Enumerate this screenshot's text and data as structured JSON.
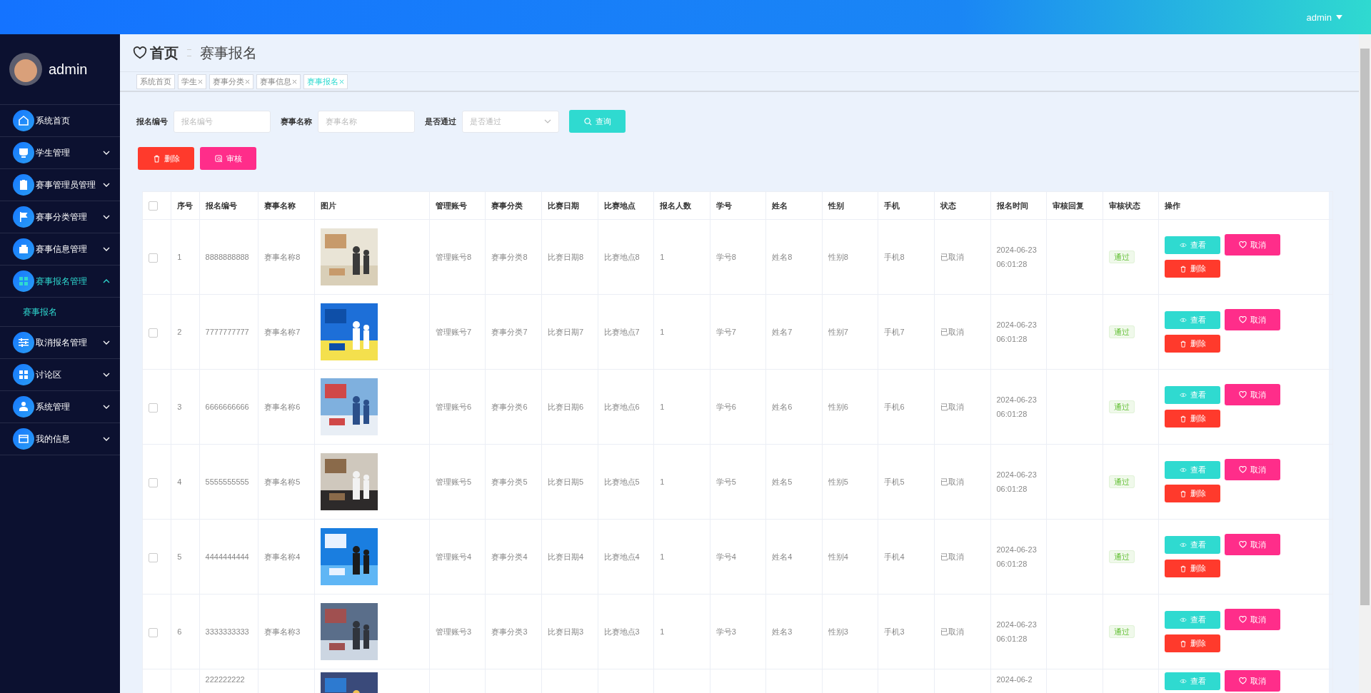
{
  "topbar": {
    "user": "admin"
  },
  "sidebar": {
    "user": "admin",
    "items": [
      {
        "label": "系统首页",
        "kind": "link",
        "selected": false
      },
      {
        "label": "学生管理",
        "kind": "group",
        "expanded": false,
        "selected": false
      },
      {
        "label": "赛事管理员管理",
        "kind": "group",
        "expanded": false,
        "selected": false
      },
      {
        "label": "赛事分类管理",
        "kind": "group",
        "expanded": false,
        "selected": false
      },
      {
        "label": "赛事信息管理",
        "kind": "group",
        "expanded": false,
        "selected": false
      },
      {
        "label": "赛事报名管理",
        "kind": "group",
        "expanded": true,
        "selected": true,
        "children": [
          {
            "label": "赛事报名",
            "selected": true
          }
        ]
      },
      {
        "label": "取消报名管理",
        "kind": "group",
        "expanded": false,
        "selected": false
      },
      {
        "label": "讨论区",
        "kind": "group",
        "expanded": false,
        "selected": false
      },
      {
        "label": "系统管理",
        "kind": "group",
        "expanded": false,
        "selected": false
      },
      {
        "label": "我的信息",
        "kind": "group",
        "expanded": false,
        "selected": false
      }
    ]
  },
  "breadcrumb": {
    "home": "首页",
    "current": "赛事报名"
  },
  "tabs": [
    {
      "label": "系统首页",
      "closable": false,
      "selected": false
    },
    {
      "label": "学生",
      "closable": true,
      "selected": false
    },
    {
      "label": "赛事分类",
      "closable": true,
      "selected": false
    },
    {
      "label": "赛事信息",
      "closable": true,
      "selected": false
    },
    {
      "label": "赛事报名",
      "closable": true,
      "selected": true
    }
  ],
  "filters": [
    {
      "label": "报名编号",
      "placeholder": "报名编号",
      "kind": "input"
    },
    {
      "label": "赛事名称",
      "placeholder": "赛事名称",
      "kind": "input"
    },
    {
      "label": "是否通过",
      "placeholder": "是否通过",
      "kind": "select"
    }
  ],
  "search_button": "查询",
  "actions": [
    {
      "label": "删除",
      "kind": "delete"
    },
    {
      "label": "审核",
      "kind": "review"
    }
  ],
  "table": {
    "all_checked": false,
    "columns": [
      "序号",
      "报名编号",
      "赛事名称",
      "图片",
      "管理账号",
      "赛事分类",
      "比赛日期",
      "比赛地点",
      "报名人数",
      "学号",
      "姓名",
      "性别",
      "手机",
      "状态",
      "报名时间",
      "审核回复",
      "审核状态",
      "操作"
    ],
    "rows": [
      {
        "checked": false,
        "cells": [
          "1",
          "8888888888",
          "赛事名称8",
          null,
          "管理账号8",
          "赛事分类8",
          "比赛日期8",
          "比赛地点8",
          "1",
          "学号8",
          "姓名8",
          "性别8",
          "手机8",
          "已取消",
          "2024-06-23 06:01:28",
          ""
        ],
        "image": {
          "kind": "picture"
        },
        "review_status": "通过",
        "buttons": [
          {
            "label": "查看",
            "kind": "view"
          },
          {
            "label": "取消",
            "kind": "cancel"
          },
          {
            "label": "删除",
            "kind": "delete"
          }
        ]
      },
      {
        "checked": false,
        "cells": [
          "2",
          "7777777777",
          "赛事名称7",
          null,
          "管理账号7",
          "赛事分类7",
          "比赛日期7",
          "比赛地点7",
          "1",
          "学号7",
          "姓名7",
          "性别7",
          "手机7",
          "已取消",
          "2024-06-23 06:01:28",
          ""
        ],
        "image": {
          "kind": "picture"
        },
        "review_status": "通过",
        "buttons": [
          {
            "label": "查看",
            "kind": "view"
          },
          {
            "label": "取消",
            "kind": "cancel"
          },
          {
            "label": "删除",
            "kind": "delete"
          }
        ]
      },
      {
        "checked": false,
        "cells": [
          "3",
          "6666666666",
          "赛事名称6",
          null,
          "管理账号6",
          "赛事分类6",
          "比赛日期6",
          "比赛地点6",
          "1",
          "学号6",
          "姓名6",
          "性别6",
          "手机6",
          "已取消",
          "2024-06-23 06:01:28",
          ""
        ],
        "image": {
          "kind": "picture"
        },
        "review_status": "通过",
        "buttons": [
          {
            "label": "查看",
            "kind": "view"
          },
          {
            "label": "取消",
            "kind": "cancel"
          },
          {
            "label": "删除",
            "kind": "delete"
          }
        ]
      },
      {
        "checked": false,
        "cells": [
          "4",
          "5555555555",
          "赛事名称5",
          null,
          "管理账号5",
          "赛事分类5",
          "比赛日期5",
          "比赛地点5",
          "1",
          "学号5",
          "姓名5",
          "性别5",
          "手机5",
          "已取消",
          "2024-06-23 06:01:28",
          ""
        ],
        "image": {
          "kind": "picture"
        },
        "review_status": "通过",
        "buttons": [
          {
            "label": "查看",
            "kind": "view"
          },
          {
            "label": "取消",
            "kind": "cancel"
          },
          {
            "label": "删除",
            "kind": "delete"
          }
        ]
      },
      {
        "checked": false,
        "cells": [
          "5",
          "4444444444",
          "赛事名称4",
          null,
          "管理账号4",
          "赛事分类4",
          "比赛日期4",
          "比赛地点4",
          "1",
          "学号4",
          "姓名4",
          "性别4",
          "手机4",
          "已取消",
          "2024-06-23 06:01:28",
          ""
        ],
        "image": {
          "kind": "picture"
        },
        "review_status": "通过",
        "buttons": [
          {
            "label": "查看",
            "kind": "view"
          },
          {
            "label": "取消",
            "kind": "cancel"
          },
          {
            "label": "删除",
            "kind": "delete"
          }
        ]
      },
      {
        "checked": false,
        "cells": [
          "6",
          "3333333333",
          "赛事名称3",
          null,
          "管理账号3",
          "赛事分类3",
          "比赛日期3",
          "比赛地点3",
          "1",
          "学号3",
          "姓名3",
          "性别3",
          "手机3",
          "已取消",
          "2024-06-23 06:01:28",
          ""
        ],
        "image": {
          "kind": "picture"
        },
        "review_status": "通过",
        "buttons": [
          {
            "label": "查看",
            "kind": "view"
          },
          {
            "label": "取消",
            "kind": "cancel"
          },
          {
            "label": "删除",
            "kind": "delete"
          }
        ]
      },
      {
        "cells": [
          "",
          "222222222",
          "",
          null,
          "",
          "",
          "",
          "",
          "",
          "",
          "",
          "",
          "",
          "",
          "2024-06-2",
          ""
        ],
        "image": {
          "kind": "picture"
        },
        "buttons": [
          {
            "label": "查看",
            "kind": "view"
          },
          {
            "label": "取消",
            "kind": "cancel"
          }
        ]
      }
    ]
  }
}
